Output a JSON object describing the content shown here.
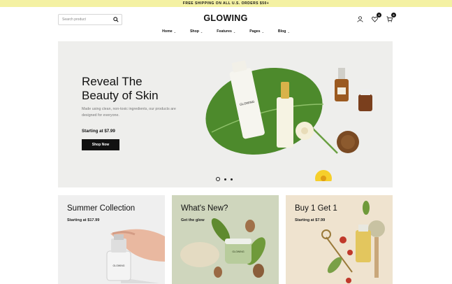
{
  "topbar": {
    "text": "FREE SHIPPING ON ALL U.S. ORDERS $50+"
  },
  "header": {
    "search_placeholder": "Search product",
    "logo": "GLOWING",
    "wishlist_count": "3",
    "cart_count": "0"
  },
  "nav": {
    "items": [
      {
        "label": "Home"
      },
      {
        "label": "Shop"
      },
      {
        "label": "Features"
      },
      {
        "label": "Pages"
      },
      {
        "label": "Blog"
      }
    ]
  },
  "hero": {
    "title": "Reveal The Beauty of Skin",
    "subtitle": "Made using clean, non-toxic ingredients, our products are designed for everyone.",
    "price": "Starting at $7.99",
    "cta": "Shop Now",
    "product_label": "GLOWING"
  },
  "cards": [
    {
      "title": "Summer Collection",
      "text": "Starting at $17.99",
      "bg": "#efefef"
    },
    {
      "title": "What's New?",
      "text": "Get the glow",
      "bg": "#cfd6bd"
    },
    {
      "title": "Buy 1 Get 1",
      "text": "Starting at $7.99",
      "bg": "#efe3cf"
    }
  ]
}
